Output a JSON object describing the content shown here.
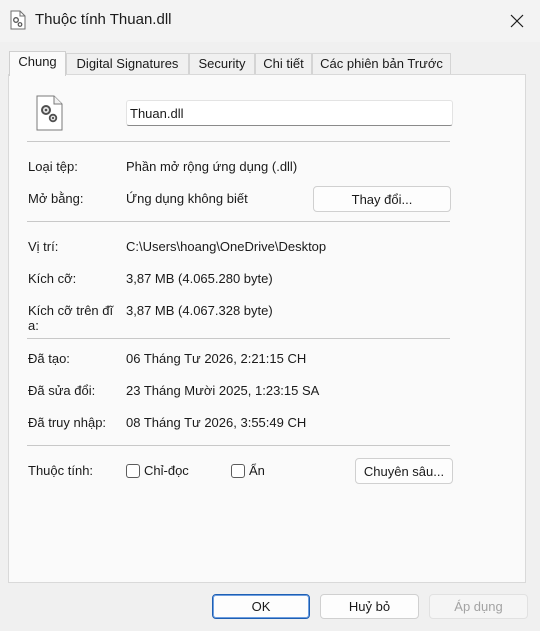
{
  "window": {
    "title": "Thuộc tính Thuan.dll",
    "close_icon": "close-icon"
  },
  "tabs": [
    {
      "label": "Chung",
      "active": true
    },
    {
      "label": "Digital Signatures"
    },
    {
      "label": "Security"
    },
    {
      "label": "Chi tiết"
    },
    {
      "label": "Các phiên bản Trước"
    }
  ],
  "general": {
    "file_icon": "dll-gear-file-icon",
    "filename": "Thuan.dll",
    "type_label": "Loại tệp:",
    "type_value": "Phần mở rộng ứng dụng (.dll)",
    "opens_label": "Mở bằng:",
    "opens_value": "Ứng dụng không biết",
    "change_button": "Thay đổi...",
    "location_label": "Vị trí:",
    "location_value": "C:\\Users\\hoang\\OneDrive\\Desktop",
    "size_label": "Kích cỡ:",
    "size_value": "3,87 MB (4.065.280 byte)",
    "size_on_disk_label": "Kích cỡ trên đĩ\na:",
    "size_on_disk_value": "3,87 MB (4.067.328 byte)",
    "created_label": "Đã tạo:",
    "created_value": "06 Tháng Tư 2026, 2:21:15 CH",
    "modified_label": "Đã sửa đổi:",
    "modified_value": "23 Tháng Mười 2025, 1:23:15 SA",
    "accessed_label": "Đã truy nhập:",
    "accessed_value": "08 Tháng Tư 2026, 3:55:49 CH",
    "attributes_label": "Thuộc tính:",
    "readonly_label": "Chỉ-đọc",
    "readonly_checked": false,
    "hidden_label": "Ẩn",
    "hidden_checked": false,
    "advanced_button": "Chuyên sâu..."
  },
  "footer": {
    "ok": "OK",
    "cancel": "Huỷ bỏ",
    "apply": "Áp dụng"
  }
}
